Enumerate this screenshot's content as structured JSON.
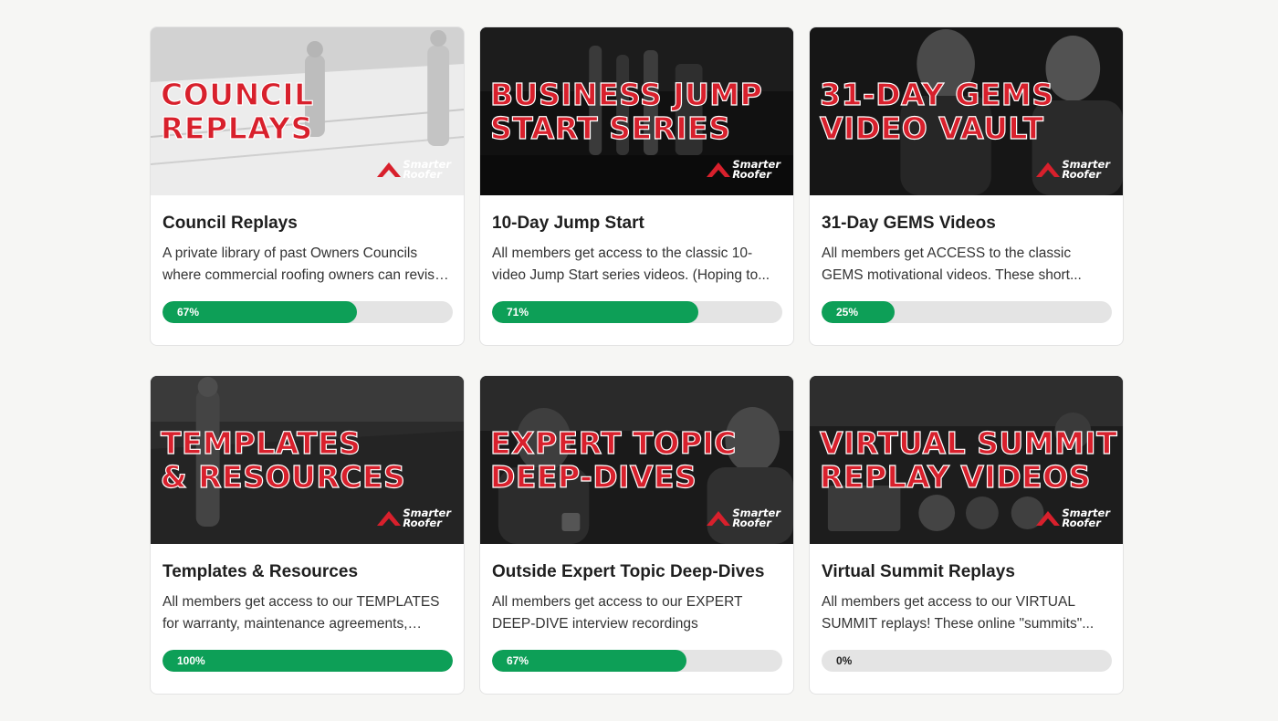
{
  "logo": {
    "line1": "Smarter",
    "line2": "Roofer"
  },
  "colors": {
    "accent_red": "#d8202c",
    "progress_green": "#0d9f57",
    "track_grey": "#e4e4e4"
  },
  "cards": [
    {
      "thumb_line1": "Council",
      "thumb_line2": "Replays",
      "title": "Council Replays",
      "description": "A private library of past Owners Councils where commercial roofing owners can revisit the discussions...",
      "progress": 67,
      "progress_label": "67%"
    },
    {
      "thumb_line1": "Business Jump",
      "thumb_line2": "Start Series",
      "title": "10-Day Jump Start",
      "description": "All members get access to the classic 10-video Jump Start series videos. (Hoping to...",
      "progress": 71,
      "progress_label": "71%"
    },
    {
      "thumb_line1": "31-Day GEMS",
      "thumb_line2": "Video Vault",
      "title": "31-Day GEMS Videos",
      "description": "All members get ACCESS to the classic GEMS motivational videos. These short...",
      "progress": 25,
      "progress_label": "25%"
    },
    {
      "thumb_line1": "Templates",
      "thumb_line2": "& Resources",
      "title": "Templates & Resources",
      "description": "All members get access to our TEMPLATES for warranty, maintenance agreements, CRM...",
      "progress": 100,
      "progress_label": "100%"
    },
    {
      "thumb_line1": "Expert Topic",
      "thumb_line2": "Deep-Dives",
      "title": "Outside Expert Topic Deep-Dives",
      "description": "All members get access to our EXPERT DEEP-DIVE interview recordings",
      "progress": 67,
      "progress_label": "67%"
    },
    {
      "thumb_line1": "Virtual Summit",
      "thumb_line2": "Replay Videos",
      "title": "Virtual Summit Replays",
      "description": "All members get access to our VIRTUAL SUMMIT replays! These online \"summits\"...",
      "progress": 0,
      "progress_label": "0%"
    }
  ]
}
